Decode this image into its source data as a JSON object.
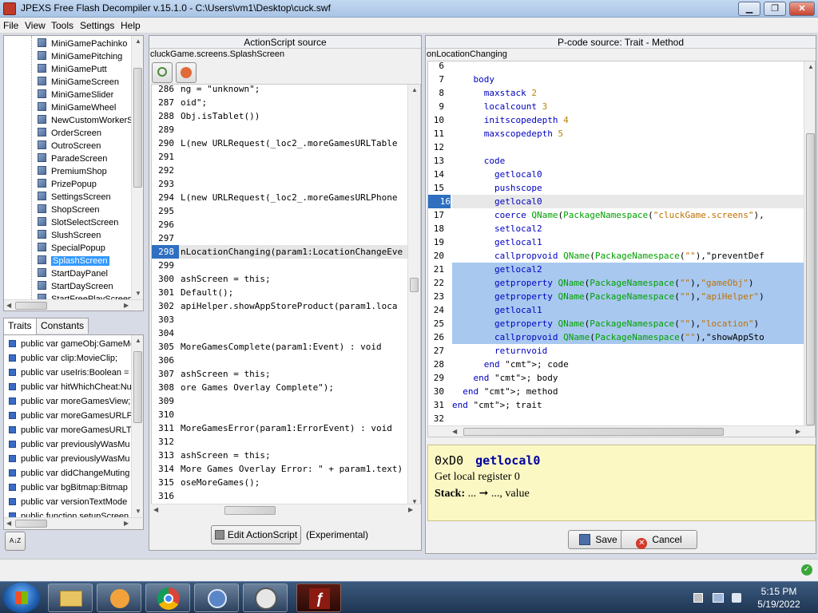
{
  "window": {
    "title": "JPEXS Free Flash Decompiler v.15.1.0 - C:\\Users\\vm1\\Desktop\\cuck.swf",
    "minimize": "▁",
    "maximize": "❐",
    "close": "✕"
  },
  "menu": [
    "File",
    "View",
    "Tools",
    "Settings",
    "Help"
  ],
  "tree": {
    "items": [
      "MiniGamePachinko",
      "MiniGamePitching",
      "MiniGamePutt",
      "MiniGameScreen",
      "MiniGameSlider",
      "MiniGameWheel",
      "NewCustomWorkerSc",
      "OrderScreen",
      "OutroScreen",
      "ParadeScreen",
      "PremiumShop",
      "PrizePopup",
      "SettingsScreen",
      "ShopScreen",
      "SlotSelectScreen",
      "SlushScreen",
      "SpecialPopup",
      "SplashScreen",
      "StartDayPanel",
      "StartDayScreen",
      "StartFreePlayScreen"
    ],
    "selected_index": 17
  },
  "traits_tabs": [
    "Traits",
    "Constants"
  ],
  "traits": [
    "public var gameObj:GameMo",
    "public var clip:MovieClip;",
    "public var useIris:Boolean =",
    "public var hitWhichCheat:Nu",
    "public var moreGamesView;",
    "public var moreGamesURLPh",
    "public var moreGamesURLTa",
    "public var previouslyWasMu",
    "public var previouslyWasMu",
    "public var didChangeMuting",
    "public var bgBitmap:Bitmap",
    "public var versionTextMode",
    "public function setupScreen"
  ],
  "sort_label": "A↓Z",
  "as_panel": {
    "header": "ActionScript source",
    "path": "cluckGame.screens.SplashScreen",
    "edit_button": "Edit ActionScript",
    "experimental": "(Experimental)",
    "current_line": "298",
    "lines": [
      {
        "n": "286",
        "t": "ng = \"unknown\";"
      },
      {
        "n": "287",
        "t": "oid\";"
      },
      {
        "n": "288",
        "t": "Obj.isTablet())"
      },
      {
        "n": "289",
        "t": ""
      },
      {
        "n": "290",
        "t": "L(new URLRequest(_loc2_.moreGamesURLTable"
      },
      {
        "n": "291",
        "t": ""
      },
      {
        "n": "292",
        "t": ""
      },
      {
        "n": "293",
        "t": ""
      },
      {
        "n": "294",
        "t": "L(new URLRequest(_loc2_.moreGamesURLPhone"
      },
      {
        "n": "295",
        "t": ""
      },
      {
        "n": "296",
        "t": ""
      },
      {
        "n": "297",
        "t": ""
      },
      {
        "n": "298",
        "t": "nLocationChanging(param1:LocationChangeEve"
      },
      {
        "n": "299",
        "t": ""
      },
      {
        "n": "300",
        "t": "ashScreen = this;"
      },
      {
        "n": "301",
        "t": "Default();"
      },
      {
        "n": "302",
        "t": "apiHelper.showAppStoreProduct(param1.loca"
      },
      {
        "n": "303",
        "t": ""
      },
      {
        "n": "304",
        "t": ""
      },
      {
        "n": "305",
        "t": "MoreGamesComplete(param1:Event) : void"
      },
      {
        "n": "306",
        "t": ""
      },
      {
        "n": "307",
        "t": "ashScreen = this;"
      },
      {
        "n": "308",
        "t": "ore Games Overlay Complete\");"
      },
      {
        "n": "309",
        "t": ""
      },
      {
        "n": "310",
        "t": ""
      },
      {
        "n": "311",
        "t": "MoreGamesError(param1:ErrorEvent) : void"
      },
      {
        "n": "312",
        "t": ""
      },
      {
        "n": "313",
        "t": "ashScreen = this;"
      },
      {
        "n": "314",
        "t": "More Games Overlay Error: \" + param1.text)"
      },
      {
        "n": "315",
        "t": "oseMoreGames();"
      },
      {
        "n": "316",
        "t": ""
      }
    ]
  },
  "pcode_panel": {
    "header": "P-code source: Trait - Method",
    "method": "onLocationChanging",
    "lines": [
      {
        "n": "6",
        "t": ""
      },
      {
        "n": "7",
        "t": "    body"
      },
      {
        "n": "8",
        "t": "      maxstack 2"
      },
      {
        "n": "9",
        "t": "      localcount 3"
      },
      {
        "n": "10",
        "t": "      initscopedepth 4"
      },
      {
        "n": "11",
        "t": "      maxscopedepth 5"
      },
      {
        "n": "12",
        "t": ""
      },
      {
        "n": "13",
        "t": "      code"
      },
      {
        "n": "14",
        "t": "        getlocal0"
      },
      {
        "n": "15",
        "t": "        pushscope"
      },
      {
        "n": "16",
        "t": "        getlocal0"
      },
      {
        "n": "17",
        "t": "        coerce QName(PackageNamespace(\"cluckGame.screens\"),"
      },
      {
        "n": "18",
        "t": "        setlocal2"
      },
      {
        "n": "19",
        "t": "        getlocal1"
      },
      {
        "n": "20",
        "t": "        callpropvoid QName(PackageNamespace(\"\"),\"preventDef"
      },
      {
        "n": "21",
        "t": "        getlocal2"
      },
      {
        "n": "22",
        "t": "        getproperty QName(PackageNamespace(\"\"),\"gameObj\")"
      },
      {
        "n": "23",
        "t": "        getproperty QName(PackageNamespace(\"\"),\"apiHelper\")"
      },
      {
        "n": "24",
        "t": "        getlocal1"
      },
      {
        "n": "25",
        "t": "        getproperty QName(PackageNamespace(\"\"),\"location\")"
      },
      {
        "n": "26",
        "t": "        callpropvoid QName(PackageNamespace(\"\"),\"showAppSto"
      },
      {
        "n": "27",
        "t": "        returnvoid"
      },
      {
        "n": "28",
        "t": "      end ; code"
      },
      {
        "n": "29",
        "t": "    end ; body"
      },
      {
        "n": "30",
        "t": "  end ; method"
      },
      {
        "n": "31",
        "t": "end ; trait"
      },
      {
        "n": "32",
        "t": ""
      }
    ],
    "current_line": "16"
  },
  "doc": {
    "opcode": "0xD0",
    "name": "getlocal0",
    "desc": "Get local register 0",
    "stack_label": "Stack:",
    "stack_value": "... ➞ ..., value"
  },
  "buttons": {
    "save": "Save",
    "cancel": "Cancel"
  },
  "clock": {
    "time": "5:15 PM",
    "date": "5/19/2022"
  },
  "colors": {
    "accent": "#3399ff",
    "doc_bg": "#fbf8c4",
    "selection": "#a8c8f0"
  }
}
